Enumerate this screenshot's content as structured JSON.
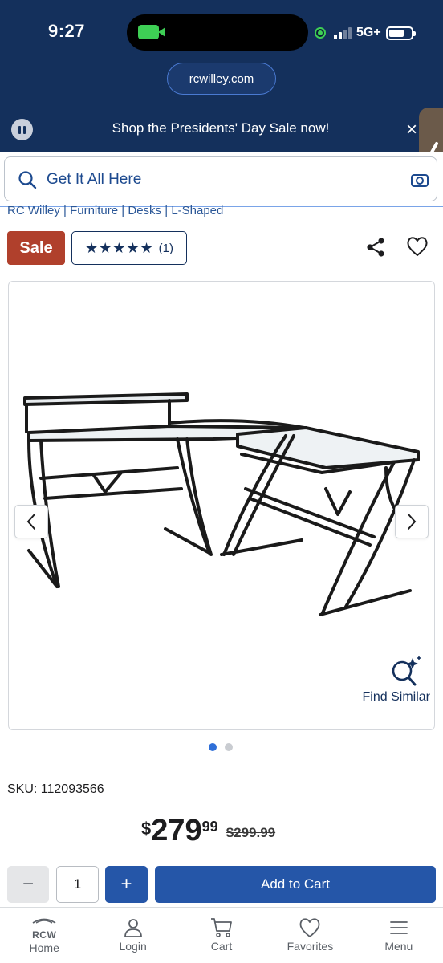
{
  "status_bar": {
    "time": "9:27",
    "network": "5G+"
  },
  "browser": {
    "url": "rcwilley.com"
  },
  "promo": {
    "text": "Shop the Presidents' Day Sale now!",
    "close": "×"
  },
  "search": {
    "placeholder": "Get It All Here"
  },
  "breadcrumb": [
    "RC Willey",
    "Furniture",
    "Desks",
    "L-Shaped"
  ],
  "product": {
    "sale_badge": "Sale",
    "stars": "★★★★★",
    "rating_count": "(1)",
    "find_similar": "Find Similar",
    "image_index": 0,
    "image_count": 2,
    "sku_label": "SKU: 112093566",
    "price_dollar": "$",
    "price_whole": "279",
    "price_cents": "99",
    "price_original": "$299.99"
  },
  "cart": {
    "minus": "−",
    "quantity": "1",
    "plus": "+",
    "add_label": "Add to Cart"
  },
  "bottom_nav": {
    "logo": "RCW",
    "items": [
      {
        "label": "Home",
        "icon": "rcw-home-icon"
      },
      {
        "label": "Login",
        "icon": "user-icon"
      },
      {
        "label": "Cart",
        "icon": "cart-icon"
      },
      {
        "label": "Favorites",
        "icon": "heart-icon"
      },
      {
        "label": "Menu",
        "icon": "hamburger-icon"
      }
    ]
  },
  "colors": {
    "navy": "#14305c",
    "sale": "#b0402c",
    "button_blue": "#2556a8",
    "link_blue": "#2b5797"
  }
}
